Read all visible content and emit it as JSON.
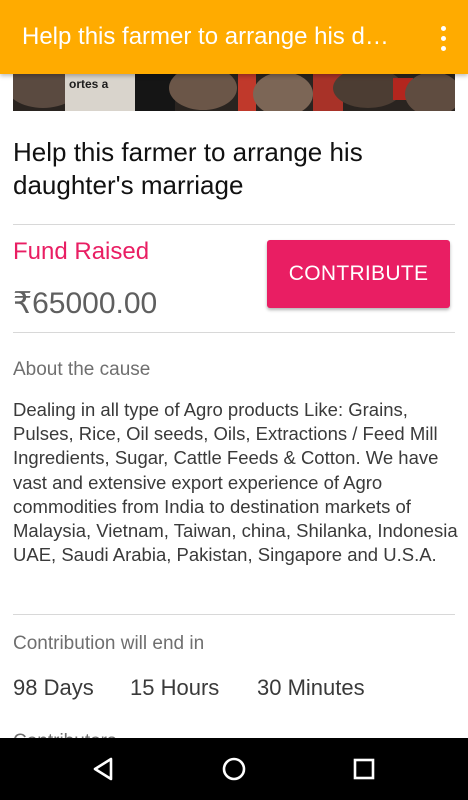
{
  "app_bar": {
    "title": "Help this farmer to arrange his daughter's marriage",
    "overflow_icon": "more-vert-icon",
    "background": "#ffab00"
  },
  "cause": {
    "title": "Help this farmer to arrange his daughter's marriage",
    "hero_banner_text": "ortes a"
  },
  "fund": {
    "label": "Fund Raised",
    "amount": "₹65000.00",
    "contribute_label": "CONTRIBUTE",
    "accent": "#e91e63"
  },
  "about": {
    "label": "About the cause",
    "description": "Dealing in all type of Agro products Like: Grains, Pulses, Rice, Oil seeds, Oils, Extractions / Feed Mill Ingredients, Sugar, Cattle Feeds & Cotton. We have vast and extensive export experience of Agro commodities from India to destination markets of Malaysia, Vietnam, Taiwan, china, Shilanka, Indonesia UAE, Saudi Arabia, Pakistan, Singapore and U.S.A."
  },
  "contribution_end": {
    "label": "Contribution will end in",
    "days": "98 Days",
    "hours": "15 Hours",
    "minutes": "30 Minutes"
  },
  "partial_next_section": "Contributors",
  "nav_bar": {
    "back_icon": "back-triangle-icon",
    "home_icon": "home-circle-icon",
    "recents_icon": "recents-square-icon"
  }
}
